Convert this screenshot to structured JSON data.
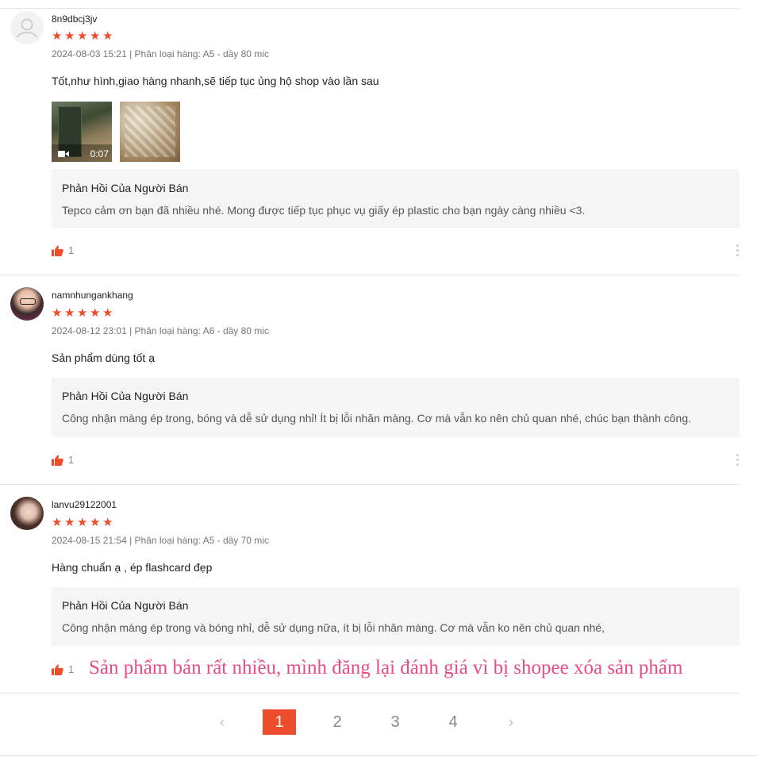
{
  "reviews": [
    {
      "username": "8n9dbcj3jv",
      "rating": 5,
      "meta": "2024-08-03 15:21 | Phân loại hàng: A5 - dầy 80 mic",
      "comment": "Tốt,như hình,giao hàng nhanh,sẽ tiếp tục ủng hộ shop vào lần sau",
      "video_duration": "0:07",
      "reply_title": "Phản Hồi Của Người Bán",
      "reply_text": "Tepco cảm ơn bạn đã nhiều nhé. Mong được tiếp tục phục vụ giấy ép plastic cho bạn ngày càng nhiều <3.",
      "likes": "1"
    },
    {
      "username": "namnhungankhang",
      "rating": 5,
      "meta": "2024-08-12 23:01 | Phân loại hàng: A6 - dầy 80 mic",
      "comment": "Sản phẩm dùng tốt ạ",
      "reply_title": "Phản Hồi Của Người Bán",
      "reply_text": "Công nhận màng ép trong, bóng và dễ sử dụng nhỉ! Ít bị lỗi nhăn màng. Cơ mà vẫn ko nên chủ quan nhé, chúc bạn thành công.",
      "likes": "1"
    },
    {
      "username": "lanvu29122001",
      "rating": 5,
      "meta": "2024-08-15 21:54 | Phân loại hàng: A5 - dầy 70 mic",
      "comment": "Hàng chuẩn ạ , ép flashcard đẹp",
      "reply_title": "Phản Hồi Của Người Bán",
      "reply_text": "Công nhận màng ép trong và bóng nhỉ, dễ sử dụng nữa, ít bị lỗi nhăn màng. Cơ mà  vẫn ko nên chủ quan nhé,",
      "likes": "1"
    }
  ],
  "watermark": "Sản phẩm bán rất nhiều, mình đăng lại đánh giá vì bị shopee xóa sản phẩm",
  "pagination": {
    "prev": "‹",
    "pages": [
      "1",
      "2",
      "3",
      "4"
    ],
    "active": "1",
    "next": "›"
  },
  "colors": {
    "accent": "#ee4d2d",
    "watermark": "#ea4b86",
    "reply_bg": "#f5f5f5"
  },
  "icons": {
    "star": "star-icon",
    "like": "thumbs-up-icon",
    "video": "video-camera-icon",
    "more": "more-vertical-icon"
  }
}
